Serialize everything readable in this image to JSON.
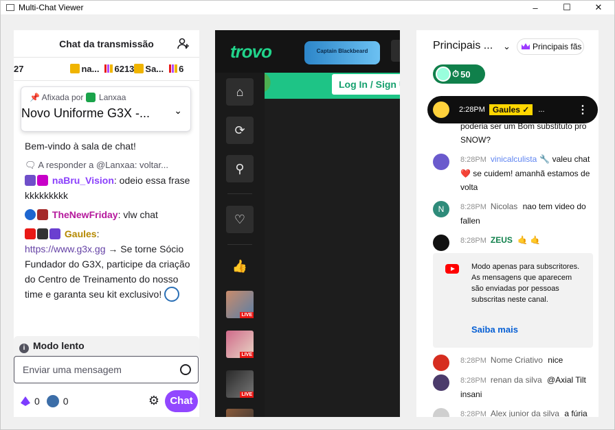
{
  "window": {
    "title": "Multi-Chat Viewer",
    "controls": [
      "–",
      "☐",
      "✕"
    ]
  },
  "twitch": {
    "header": "Chat da transmissão",
    "sub_leaders": [
      {
        "value": "27"
      },
      {
        "value": "na..."
      },
      {
        "value": "6213"
      },
      {
        "value": "Sa..."
      },
      {
        "value": "6"
      }
    ],
    "pinned": {
      "by_label": "Afixada por",
      "by_user": "Lanxaa",
      "message": "Novo Uniforme G3X -..."
    },
    "messages": [
      {
        "text": "Bem-vindo à sala de chat!"
      },
      {
        "reply": "A responder a @Lanxaa: voltar..."
      },
      {
        "user": "naBru_Vision",
        "user_color": "#8a3ffc",
        "text": "odeio essa frase kkkkkkkkk"
      },
      {
        "user": "TheNewFriday",
        "user_color": "#b5189c",
        "text": "vlw chat"
      },
      {
        "user": "Gaules",
        "user_color": "#b58900",
        "link": "https://www.g3x.gg",
        "text": "→ Se torne Sócio Fundador do G3X, participe da criação do Centro de Treinamento do nosso time e garanta seu kit exclusivo!"
      }
    ],
    "slow_mode": "Modo lento",
    "input_placeholder": "Enviar uma mensagem",
    "points_a": "0",
    "points_b": "0",
    "chat_button": "Chat"
  },
  "trovo": {
    "logo": "trovo",
    "banner": "Captain Blackbeard",
    "login_label": "Log In / Sign U",
    "live_tag": "LIVE"
  },
  "youtube": {
    "header_title": "Principais ...",
    "fans_button": "Principais fãs",
    "viewer_count": "50",
    "ticker": {
      "time": "2:28PM",
      "name": "Gaules ✓",
      "text": "..."
    },
    "partial_message": "poderia ser um Bom substituto pro SNOW?",
    "messages": [
      {
        "time": "8:28PM",
        "author": "vinicalculista",
        "mod": true,
        "text": "valeu chat ❤️ se cuidem! amanhã estamos de volta",
        "avatar": "#6a5acd"
      },
      {
        "time": "8:28PM",
        "author": "Nicolas",
        "text": "nao tem video do fallen",
        "avatar": "#2e8b7a",
        "initial": "N"
      },
      {
        "time": "8:28PM",
        "author": "ZEUS",
        "green": true,
        "text": "🤙 🤙",
        "avatar": "#111111"
      }
    ],
    "notice": {
      "text": "Modo apenas para subscritores. As mensagens que aparecem são enviadas por pessoas subscritas neste canal.",
      "link": "Saiba mais"
    },
    "messages_after": [
      {
        "time": "8:28PM",
        "author": "Nome Criativo",
        "text": "nice",
        "avatar": "#d62d20"
      },
      {
        "time": "8:28PM",
        "author": "renan da silva",
        "text": "@Axial Tilt insani",
        "avatar": "#4b3b6b"
      },
      {
        "time": "8:28PM",
        "author": "Alex junior da silva",
        "text": "a fúria joga hj contra Astralis???",
        "avatar": "#cfcfcf"
      }
    ]
  }
}
